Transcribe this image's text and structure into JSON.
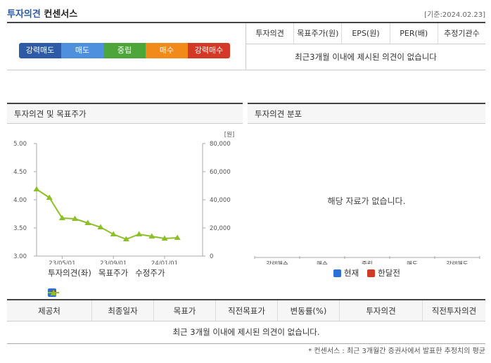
{
  "header": {
    "title": "투자의견",
    "subtitle": "컨센서스",
    "date": "[기준:2024.02.23]"
  },
  "opinion_scale": [
    {
      "label": "강력매도",
      "color": "#2f5ba6"
    },
    {
      "label": "매도",
      "color": "#4f90de"
    },
    {
      "label": "중립",
      "color": "#4ca63a"
    },
    {
      "label": "매수",
      "color": "#f28a1a"
    },
    {
      "label": "강력매수",
      "color": "#d33a26"
    }
  ],
  "consensus_table": {
    "columns": [
      "투자의견",
      "목표주가(원)",
      "EPS(원)",
      "PER(배)",
      "추정기관수"
    ],
    "empty_message": "최근3개월 이내에 제시된 의견이 없습니다"
  },
  "left_panel": {
    "title": "투자의견 및 목표주가",
    "legend": [
      {
        "label": "투자의견(좌)",
        "icon": "square-icon",
        "color": "#2d6fd6"
      },
      {
        "label": "목표주가",
        "icon": "dot-line-icon",
        "color": "#c33222"
      },
      {
        "label": "수정주가",
        "icon": "triangle-line-icon",
        "color": "#8cbf2a"
      }
    ]
  },
  "chart_data": {
    "type": "line",
    "left_axis": {
      "ticks": [
        "5.00",
        "4.50",
        "4.00",
        "3.50",
        "3.00"
      ],
      "range": [
        3.0,
        5.0
      ]
    },
    "right_axis": {
      "unit": "[원]",
      "ticks": [
        "80,000",
        "60,000",
        "40,000",
        "20,000",
        "0"
      ],
      "range": [
        0,
        80000
      ]
    },
    "x_ticks": [
      "23/05/01",
      "23/09/01",
      "24/01/01"
    ],
    "series": [
      {
        "name": "수정주가",
        "color": "#8cbf2a",
        "x": [
          "2023-03",
          "2023-04",
          "2023-05",
          "2023-06",
          "2023-07",
          "2023-08",
          "2023-09",
          "2023-10",
          "2023-11",
          "2023-12",
          "2024-01",
          "2024-02"
        ],
        "values": [
          47500,
          41500,
          27000,
          26500,
          23500,
          20500,
          15500,
          12000,
          15500,
          14000,
          12500,
          13000
        ]
      }
    ]
  },
  "right_panel": {
    "title": "투자의견 분포",
    "no_data": "해당 자료가 없습니다.",
    "categories": [
      "강력매수",
      "매수",
      "중립",
      "매도",
      "강력매도"
    ],
    "legend": [
      {
        "label": "현재",
        "color": "#2d6fd6"
      },
      {
        "label": "한달전",
        "color": "#d33a26"
      }
    ]
  },
  "detail_table": {
    "columns": [
      "제공처",
      "최종일자",
      "목표가",
      "직전목표가",
      "변동률(%)",
      "투자의견",
      "직전투자의견"
    ],
    "empty_message": "최근 3개월 이내에 제시된 의견이 없습니다."
  },
  "footnote": "* 컨센서스 : 최근 3개월간 증권사에서 발표한 추정치의 평균"
}
